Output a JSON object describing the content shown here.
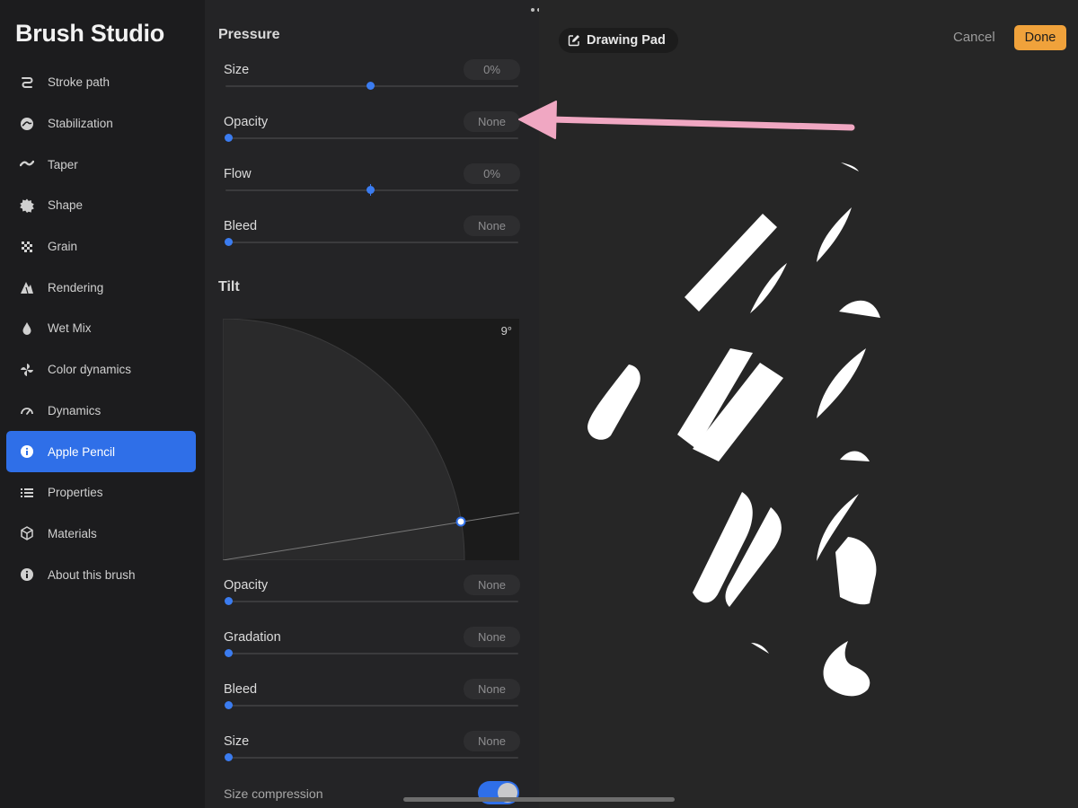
{
  "app": {
    "title": "Brush Studio"
  },
  "sidebar": {
    "items": [
      {
        "label": "Stroke path",
        "icon": "stroke-path-icon"
      },
      {
        "label": "Stabilization",
        "icon": "stabilization-icon"
      },
      {
        "label": "Taper",
        "icon": "taper-icon"
      },
      {
        "label": "Shape",
        "icon": "shape-icon"
      },
      {
        "label": "Grain",
        "icon": "grain-icon"
      },
      {
        "label": "Rendering",
        "icon": "rendering-icon"
      },
      {
        "label": "Wet Mix",
        "icon": "wet-mix-icon"
      },
      {
        "label": "Color dynamics",
        "icon": "color-dynamics-icon"
      },
      {
        "label": "Dynamics",
        "icon": "dynamics-icon"
      },
      {
        "label": "Apple Pencil",
        "icon": "info-icon",
        "active": true
      },
      {
        "label": "Properties",
        "icon": "list-icon"
      },
      {
        "label": "Materials",
        "icon": "cube-icon"
      },
      {
        "label": "About this brush",
        "icon": "info-icon"
      }
    ]
  },
  "pressure": {
    "title": "Pressure",
    "size": {
      "label": "Size",
      "value": "0%",
      "level": 0.5
    },
    "opacity": {
      "label": "Opacity",
      "value": "None",
      "level": 0
    },
    "flow": {
      "label": "Flow",
      "value": "0%",
      "level": 0.5
    },
    "bleed": {
      "label": "Bleed",
      "value": "None",
      "level": 0
    }
  },
  "tilt": {
    "title": "Tilt",
    "angle": "9°",
    "opacity": {
      "label": "Opacity",
      "value": "None",
      "level": 0
    },
    "gradation": {
      "label": "Gradation",
      "value": "None",
      "level": 0
    },
    "bleed": {
      "label": "Bleed",
      "value": "None",
      "level": 0
    },
    "size": {
      "label": "Size",
      "value": "None",
      "level": 0
    },
    "size_compression": {
      "label": "Size compression",
      "on": true
    }
  },
  "pad": {
    "title": "Drawing Pad",
    "cancel_label": "Cancel",
    "done_label": "Done"
  },
  "colors": {
    "accent": "#2f6fe8",
    "done": "#f0a23b",
    "annotation_arrow": "#f0a7c2"
  }
}
